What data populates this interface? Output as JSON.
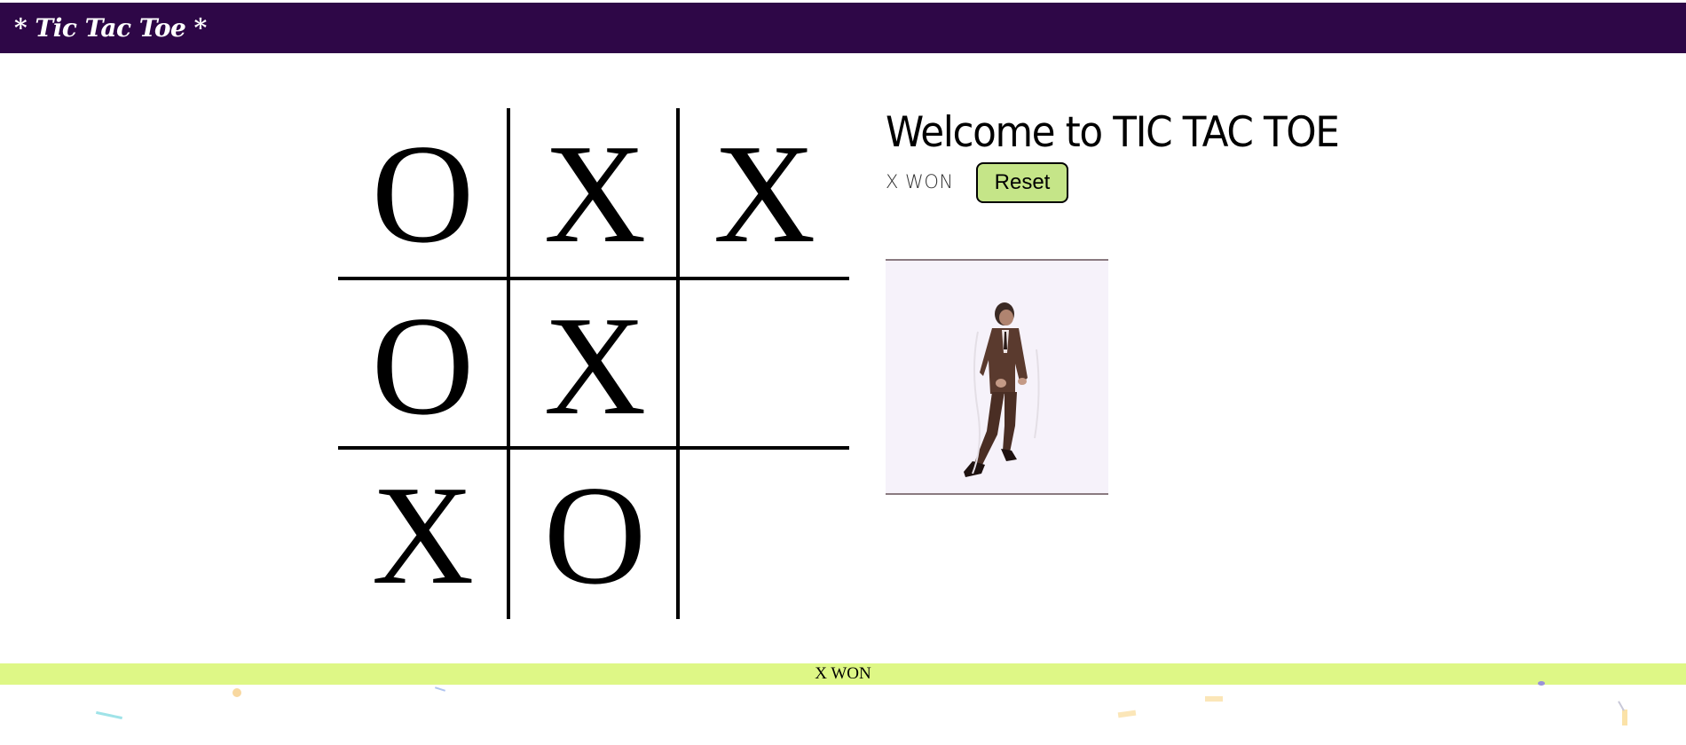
{
  "header": {
    "title": "* Tic Tac Toe *"
  },
  "board": {
    "cells": [
      "O",
      "X",
      "X",
      "O",
      "X",
      "",
      "X",
      "O",
      ""
    ]
  },
  "info": {
    "welcome": "Welcome to TIC TAC TOE",
    "status": "X WON",
    "reset_label": "Reset"
  },
  "footer": {
    "message": "X WON"
  },
  "colors": {
    "header_bg": "#2e0747",
    "footer_bg": "#def786",
    "reset_bg": "#c5e588"
  }
}
